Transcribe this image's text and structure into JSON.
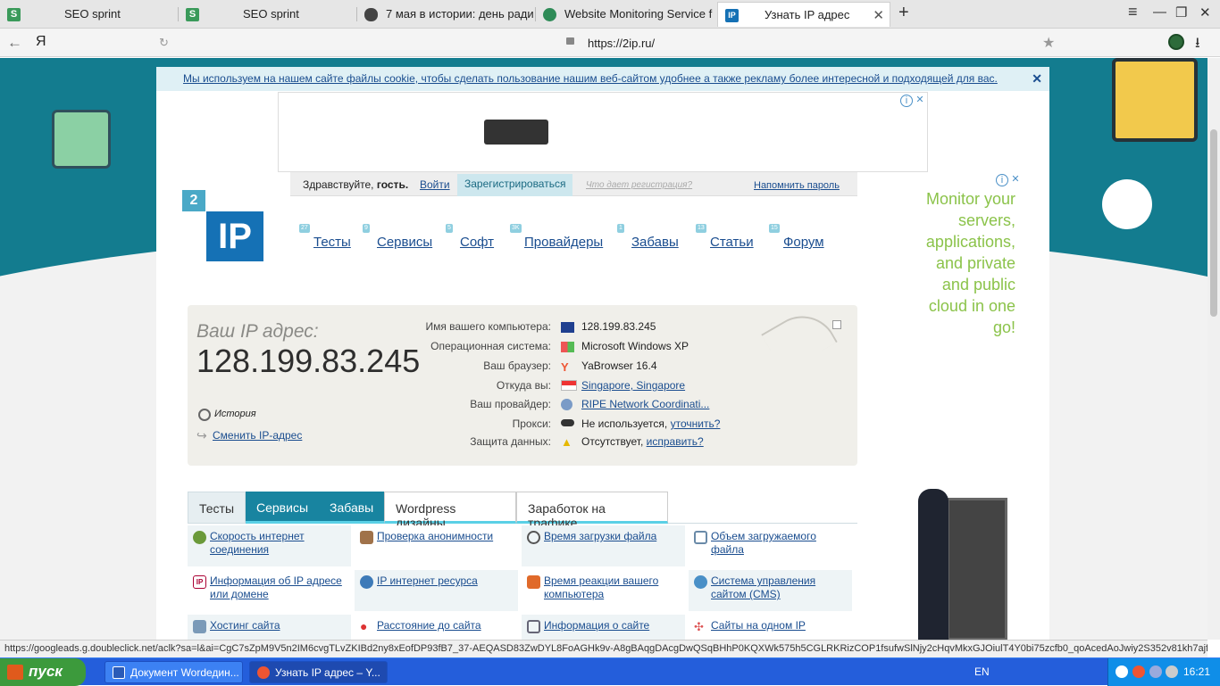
{
  "browser": {
    "tabs": [
      {
        "title": "SEO sprint",
        "icon": "seosprint-icon"
      },
      {
        "title": "SEO sprint",
        "icon": "seosprint-icon"
      },
      {
        "title": "7 мая в истории: день ради",
        "icon": "mouse-icon"
      },
      {
        "title": "Website Monitoring Service f",
        "icon": "monitor-icon"
      },
      {
        "title": "Узнать IP адрес",
        "icon": "ip-icon"
      }
    ],
    "browser_logo": "Я",
    "url": "https://2ip.ru/"
  },
  "cookie_notice": {
    "text": "Мы используем на нашем сайте файлы cookie, чтобы сделать пользование нашим веб-сайтом удобнее а также рекламу более интересной и подходящей для вас."
  },
  "auth": {
    "greeting_prefix": "Здравствуйте,",
    "greeting_user": "гость.",
    "login": "Войти",
    "register": "Зарегистрироваться",
    "what_reg": "Что дает регистрация?",
    "remind": "Напомнить пароль"
  },
  "logo": {
    "badge": "2",
    "text": "IP"
  },
  "nav": [
    {
      "label": "Тесты",
      "count": "27"
    },
    {
      "label": "Сервисы",
      "count": "9"
    },
    {
      "label": "Софт",
      "count": "5"
    },
    {
      "label": "Провайдеры",
      "count": "3K"
    },
    {
      "label": "Забавы",
      "count": "1"
    },
    {
      "label": "Статьи",
      "count": "13"
    },
    {
      "label": "Форум",
      "count": "15"
    }
  ],
  "ip_info": {
    "label": "Ваш IP адрес:",
    "ip": "128.199.83.245",
    "history": "История",
    "change_ip": "Сменить IP-адрес",
    "rows": [
      {
        "label": "Имя вашего компьютера:",
        "value": "128.199.83.245",
        "link": "",
        "icon": "computer-icon"
      },
      {
        "label": "Операционная система:",
        "value": "Microsoft Windows XP",
        "link": "",
        "icon": "windows-icon"
      },
      {
        "label": "Ваш браузер:",
        "value": "YaBrowser 16.4",
        "link": "",
        "icon": "yandex-icon"
      },
      {
        "label": "Откуда вы:",
        "value": "",
        "link": "Singapore, Singapore",
        "icon": "flag-icon"
      },
      {
        "label": "Ваш провайдер:",
        "value": "",
        "link": "RIPE Network Coordinati...",
        "icon": "globe-icon"
      },
      {
        "label": "Прокси:",
        "value": "Не используется,",
        "link": "уточнить?",
        "icon": "glasses-icon"
      },
      {
        "label": "Защита данных:",
        "value": "Отсутствует,",
        "link": "исправить?",
        "icon": "warning-icon"
      }
    ]
  },
  "section_tabs": [
    "Тесты",
    "Сервисы",
    "Забавы",
    "Wordpress дизайны",
    "Заработок на трафике"
  ],
  "services": [
    "Скорость интернет соединения",
    "Проверка анонимности",
    "Время загрузки файла",
    "Объем загружаемого файла",
    "Информация об IP адресе или домене",
    "IP интернет ресурса",
    "Время реакции вашего компьютера",
    "Система управления сайтом (CMS)",
    "Хостинг сайта",
    "Расстояние до сайта",
    "Информация о сайте",
    "Сайты на одном IP"
  ],
  "ad_right": {
    "text": "Monitor your servers, applications, and private and public cloud in one go!"
  },
  "status_url": "https://googleads.g.doubleclick.net/aclk?sa=l&ai=CgC7sZpM9V5n2IM6cvgTLvZKIBd2ny8xEofDP93fB7_37-AEQASD83ZwDYL8FoAGHk9v-A8gBAqgDAcgDwQSqBHhP0KQXWk575h5CGLRKRizCOP1fsufwSlNjy2cHqvMkxGJOiulT4Y0bi75zcfb0_qoAcedAoJwiy2S352v81kh7ajfLlesHeK8...",
  "taskbar": {
    "start": "пуск",
    "tasks": [
      "Документ Wordедин...",
      "Узнать IP адрес – Y..."
    ],
    "lang": "EN",
    "time": "16:21"
  },
  "colors": {
    "accent_teal": "#137c8f",
    "logo_blue": "#1571b5",
    "link": "#1a4d8f",
    "ad_green": "#8bc34a"
  }
}
